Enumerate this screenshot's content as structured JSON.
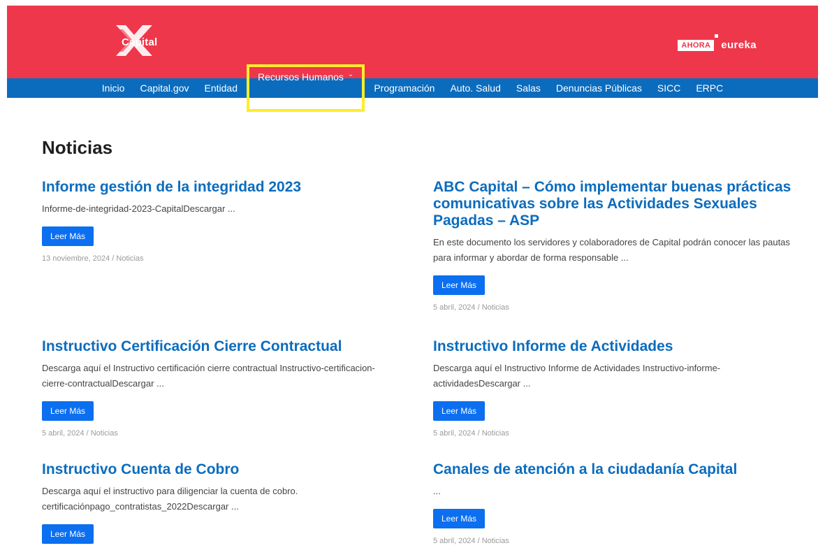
{
  "header": {
    "logo_text": "Capital",
    "partners": {
      "ahora": "AHORA",
      "eureka": "eureka"
    }
  },
  "nav": {
    "items": [
      {
        "label": "Inicio"
      },
      {
        "label": "Capital.gov"
      },
      {
        "label": "Entidad"
      },
      {
        "label": "Recursos Humanos",
        "has_dropdown": true,
        "highlighted": true
      },
      {
        "label": "Programación"
      },
      {
        "label": "Auto. Salud"
      },
      {
        "label": "Salas"
      },
      {
        "label": "Denuncias Públicas"
      },
      {
        "label": "SICC"
      },
      {
        "label": "ERPC"
      }
    ]
  },
  "main": {
    "title": "Noticias",
    "read_more": "Leer Más",
    "posts": [
      {
        "title": "Informe gestión de la integridad 2023",
        "excerpt": "Informe-de-integridad-2023-CapitalDescargar ...",
        "meta": "13 noviembre, 2024 / Noticias"
      },
      {
        "title": "ABC Capital – Cómo implementar buenas prácticas comunicativas sobre las Actividades Sexuales Pagadas – ASP",
        "excerpt": "En este documento los servidores y colaboradores de Capital podrán conocer las pautas para informar y abordar de forma responsable ...",
        "meta": "5 abril, 2024 / Noticias"
      },
      {
        "title": "Instructivo Certificación Cierre Contractual",
        "excerpt": "Descarga aquí el Instructivo certificación cierre contractual Instructivo-certificacion-cierre-contractualDescargar ...",
        "meta": "5 abril, 2024 / Noticias"
      },
      {
        "title": "Instructivo Informe de Actividades",
        "excerpt": "Descarga aquí el Instructivo Informe de Actividades Instructivo-informe-actividadesDescargar ...",
        "meta": "5 abril, 2024 / Noticias"
      },
      {
        "title": "Instructivo Cuenta de Cobro",
        "excerpt": "Descarga aquí el instructivo para diligenciar la cuenta de cobro. certificaciónpago_contratistas_2022Descargar ...",
        "meta": ""
      },
      {
        "title": "Canales de atención a la ciudadanía Capital",
        "excerpt": "...",
        "meta": "5 abril, 2024 / Noticias"
      }
    ]
  },
  "colors": {
    "header_red": "#ee374b",
    "nav_blue": "#0b6cbe",
    "link_blue": "#0b6cbe",
    "button_blue": "#0b6ff0",
    "highlight_yellow": "#ffed2b"
  }
}
